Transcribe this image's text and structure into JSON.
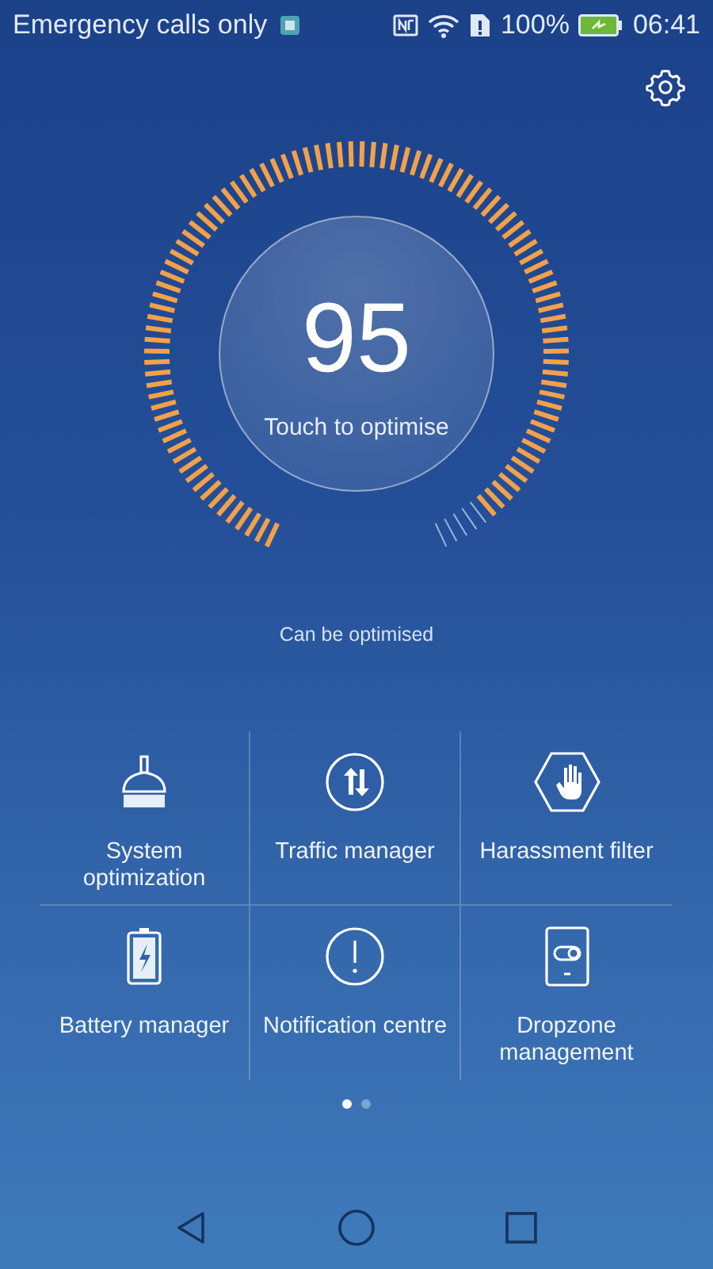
{
  "status_bar": {
    "carrier": "Emergency calls only",
    "battery": "100%",
    "time": "06:41"
  },
  "gauge": {
    "score": "95",
    "action": "Touch to optimise"
  },
  "status_text": "Can be optimised",
  "tools": [
    {
      "kind": "broom",
      "label": "System optimization"
    },
    {
      "kind": "traffic",
      "label": "Traffic manager"
    },
    {
      "kind": "hand",
      "label": "Harassment filter"
    },
    {
      "kind": "battery",
      "label": "Battery manager"
    },
    {
      "kind": "alert",
      "label": "Notification centre"
    },
    {
      "kind": "dropzone",
      "label": "Dropzone management"
    }
  ],
  "pages": [
    {
      "selected": true
    },
    {
      "selected": false
    }
  ]
}
